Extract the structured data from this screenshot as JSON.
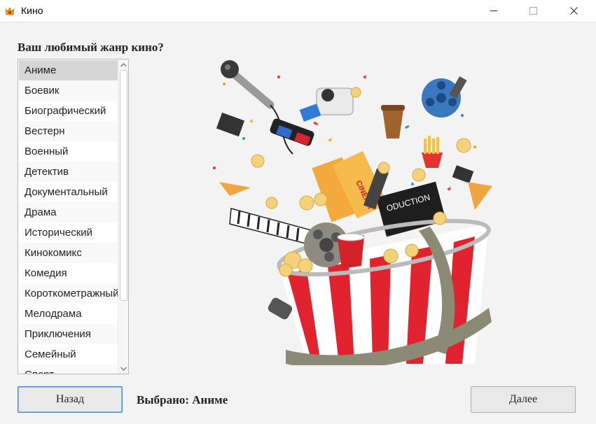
{
  "window": {
    "title": "Кино"
  },
  "question": "Ваш любимый жанр кино?",
  "genres": {
    "items": [
      "Аниме",
      "Боевик",
      "Биографический",
      "Вестерн",
      "Военный",
      "Детектив",
      "Документальный",
      "Драма",
      "Исторический",
      "Кинокомикс",
      "Комедия",
      "Короткометражный",
      "Мелодрама",
      "Приключения",
      "Семейный",
      "Спорт"
    ],
    "selected_index": 0
  },
  "status": {
    "selected_text": "Выбрано: Аниме"
  },
  "buttons": {
    "back": "Назад",
    "next": "Далее"
  },
  "illustration": {
    "ticket_text": "CINEMA",
    "clapper_text": "ODUCTION"
  },
  "colors": {
    "accent": "#3f8bd9",
    "selected_bg": "#d6d6d6",
    "popcorn_red": "#e0232e"
  }
}
